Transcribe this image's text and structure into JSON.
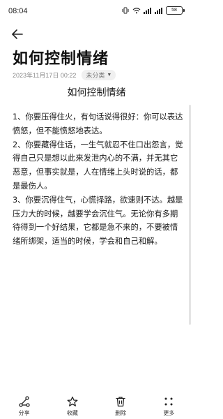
{
  "status_bar": {
    "time": "08:04",
    "battery": "58",
    "icons": [
      "vibrate-icon",
      "wifi-icon",
      "signal-icon",
      "signal-icon",
      "battery-icon"
    ]
  },
  "header": {
    "back_icon": "back-arrow-icon"
  },
  "note": {
    "title": "如何控制情绪",
    "date": "2023年11月17日 00:22",
    "category": "未分类",
    "heading": "如何控制情绪",
    "paragraphs": [
      "1、你要压得住火，有句话说得很好：你可以表达愤怒，但不能愤怒地表达。",
      "2、你要藏得住话，一生气就忍不住口出怨言，觉得自己只是想以此来发泄内心的不满，并无其它恶意，但事实就是，人在情绪上头时说的话，都是最伤人。",
      "3、你要沉得住气，心慌择路，欲速则不达。越是压力大的时候，越要学会沉住气。无论你有多期待得到一个好结果，它都是急不来的，不要被情绪所绑架，适当的时候，学会和自己和解。"
    ]
  },
  "bottom_bar": {
    "share": "分享",
    "favorite": "收藏",
    "delete": "删除",
    "more": "更多"
  },
  "colors": {
    "text": "#1a1a1a",
    "meta": "#8a8a8a",
    "chip_bg": "#f0f0f0",
    "background": "#ffffff"
  }
}
